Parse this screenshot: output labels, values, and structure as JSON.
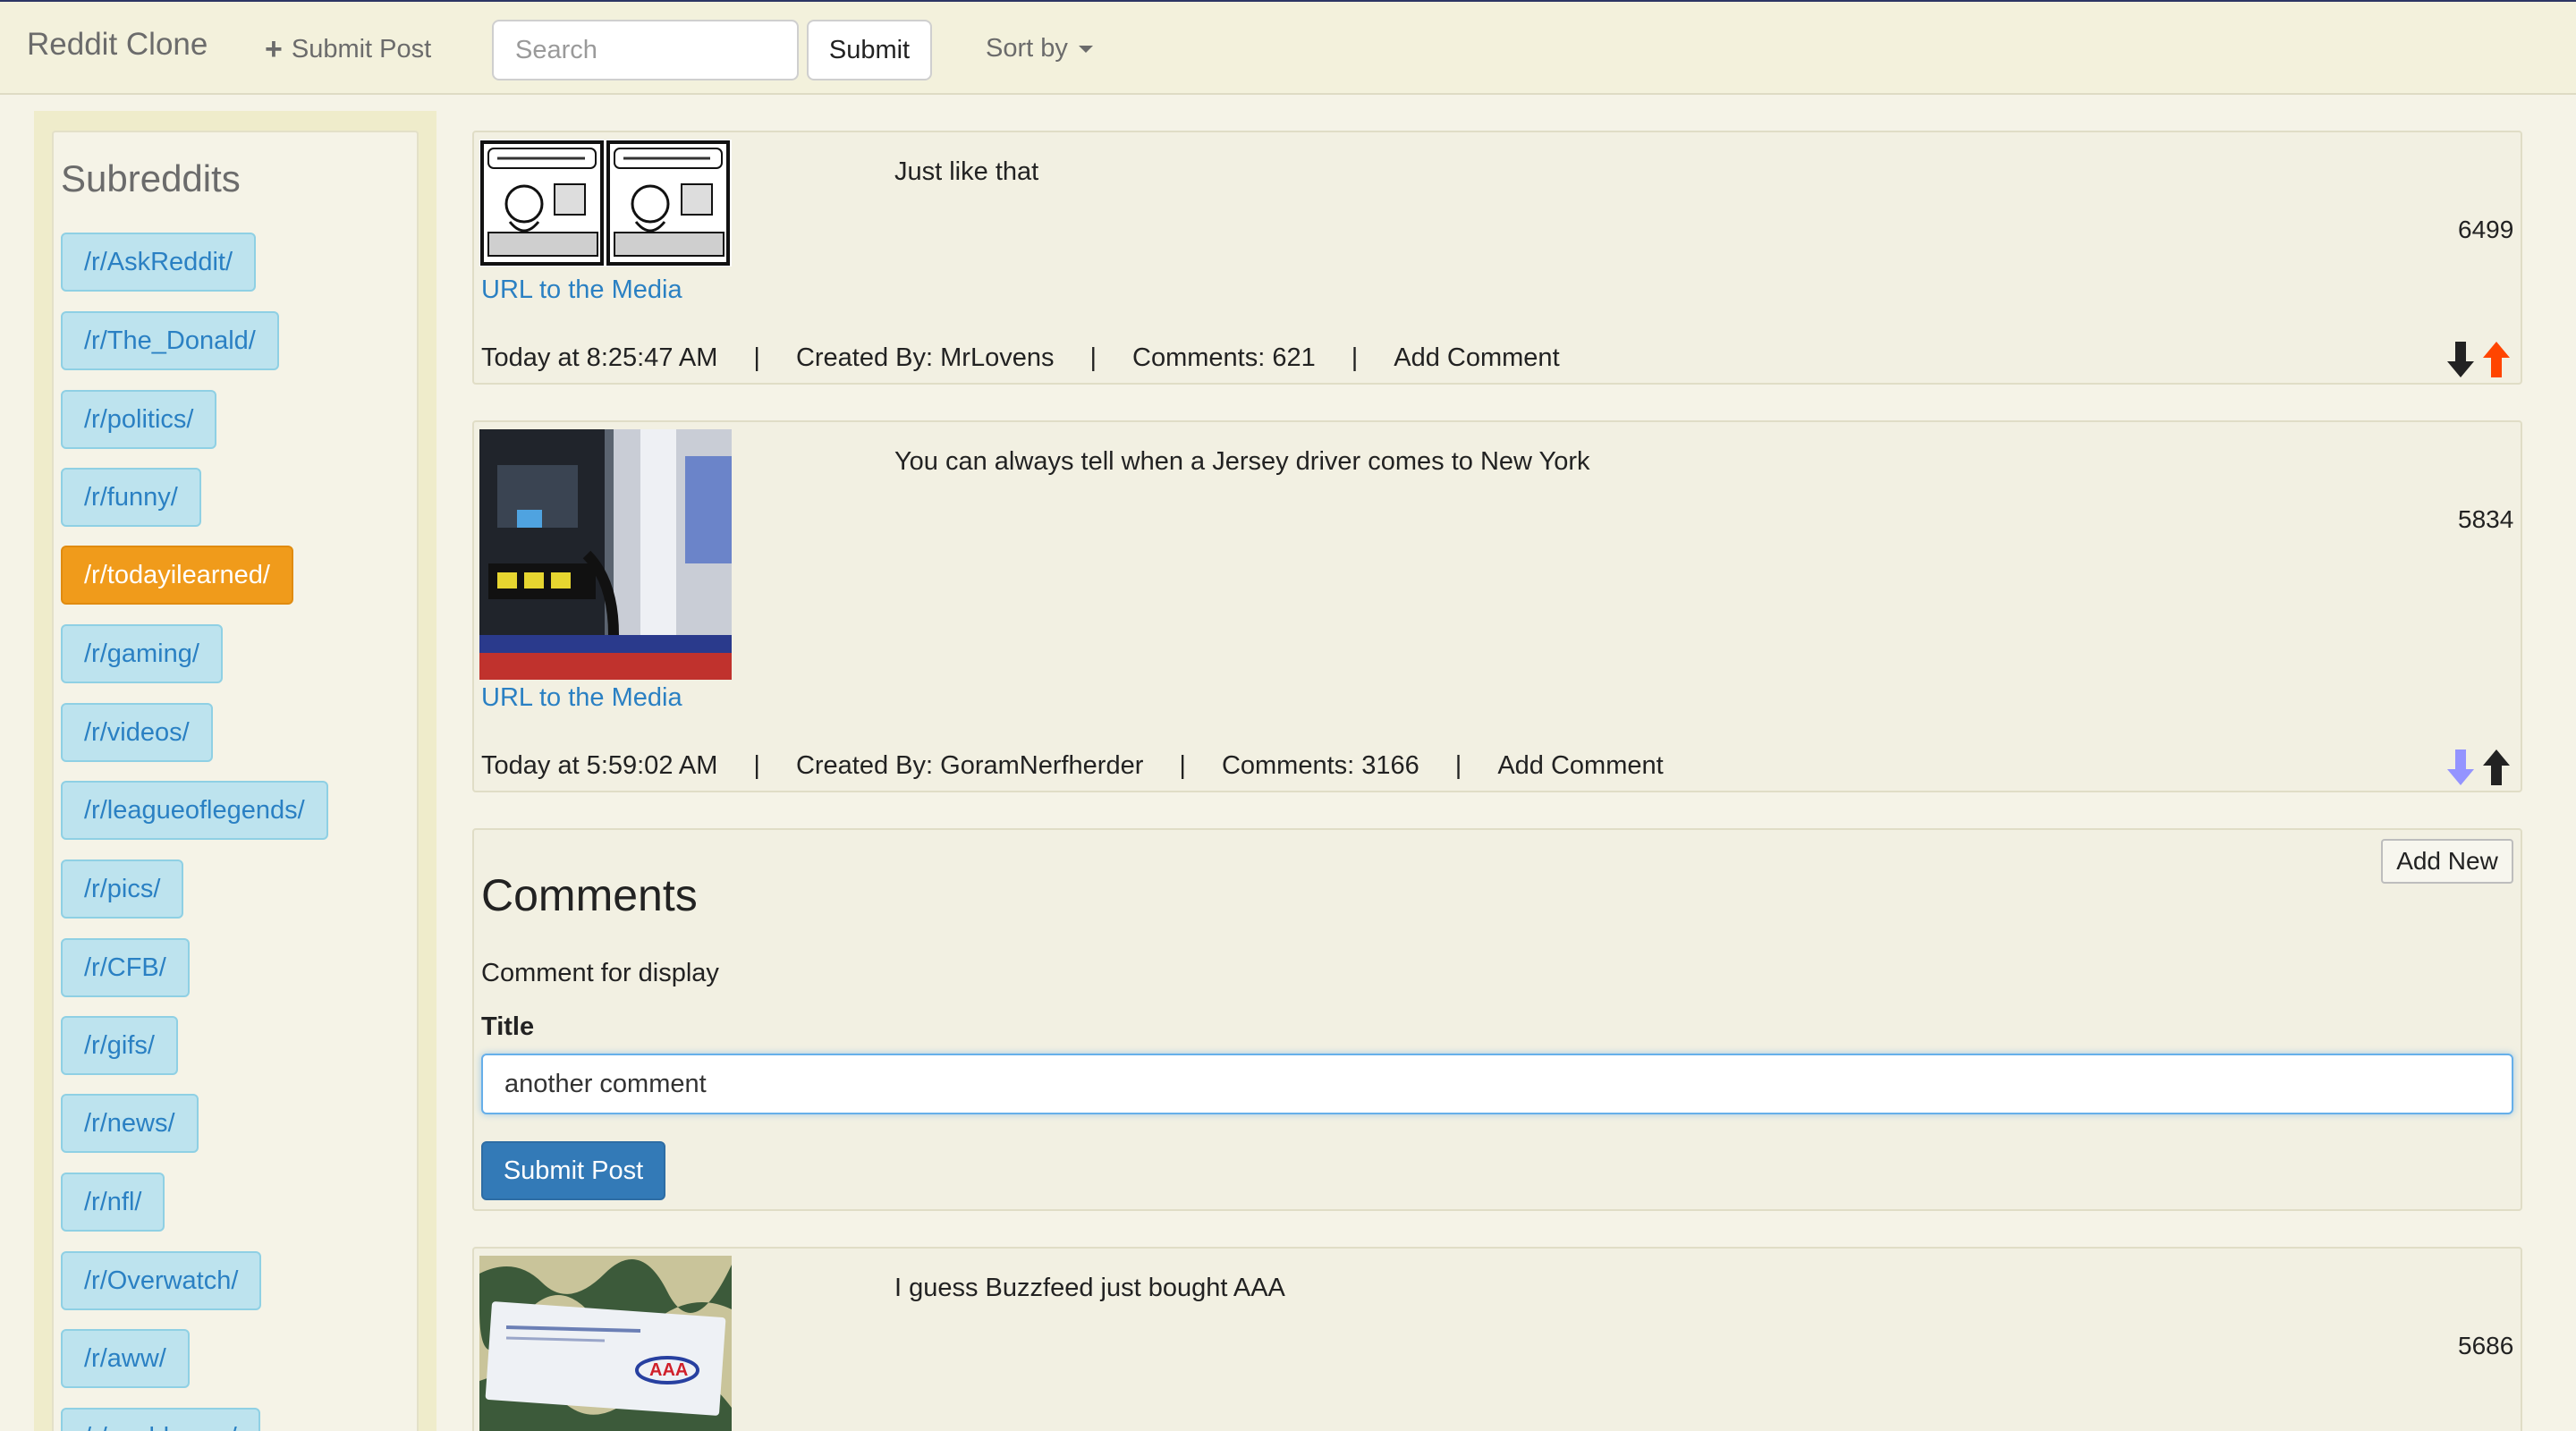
{
  "navbar": {
    "brand": "Reddit Clone",
    "submit_post": "Submit Post",
    "search_placeholder": "Search",
    "search_button": "Submit",
    "sort_by": "Sort by"
  },
  "sidebar": {
    "title": "Subreddits",
    "active": "/r/todayilearned/",
    "items": [
      "/r/AskReddit/",
      "/r/The_Donald/",
      "/r/politics/",
      "/r/funny/",
      "/r/todayilearned/",
      "/r/gaming/",
      "/r/videos/",
      "/r/leagueoflegends/",
      "/r/pics/",
      "/r/CFB/",
      "/r/gifs/",
      "/r/news/",
      "/r/nfl/",
      "/r/Overwatch/",
      "/r/aww/",
      "/r/worldnews/"
    ]
  },
  "posts": [
    {
      "title": "Just like that",
      "media_link": "URL to the Media",
      "time": "Today at 8:25:47 AM",
      "author": "Created By: MrLovens",
      "comments": "Comments: 621",
      "add_comment": "Add Comment",
      "score": "6499",
      "vote": "upvoted",
      "thumbnail": "comic-strip"
    },
    {
      "title": "You can always tell when a Jersey driver comes to New York",
      "media_link": "URL to the Media",
      "time": "Today at 5:59:02 AM",
      "author": "Created By: GoramNerfherder",
      "comments": "Comments: 3166",
      "add_comment": "Add Comment",
      "score": "5834",
      "vote": "downvoted",
      "thumbnail": "gas-pump-photo"
    },
    {
      "title": "I guess Buzzfeed just bought AAA",
      "score": "5686",
      "thumbnail": "aaa-envelope-photo"
    }
  ],
  "comments_form": {
    "heading": "Comments",
    "add_new": "Add New",
    "comment_text": "Comment for display",
    "title_label": "Title",
    "title_value": "another comment",
    "submit": "Submit Post"
  },
  "colors": {
    "upvote_active": "#ff4500",
    "downvote_active": "#9494ff",
    "vote_inactive": "#222222",
    "subreddit_bg": "#bde3ee",
    "subreddit_active": "#f09b1b",
    "primary_button": "#337ab7"
  }
}
